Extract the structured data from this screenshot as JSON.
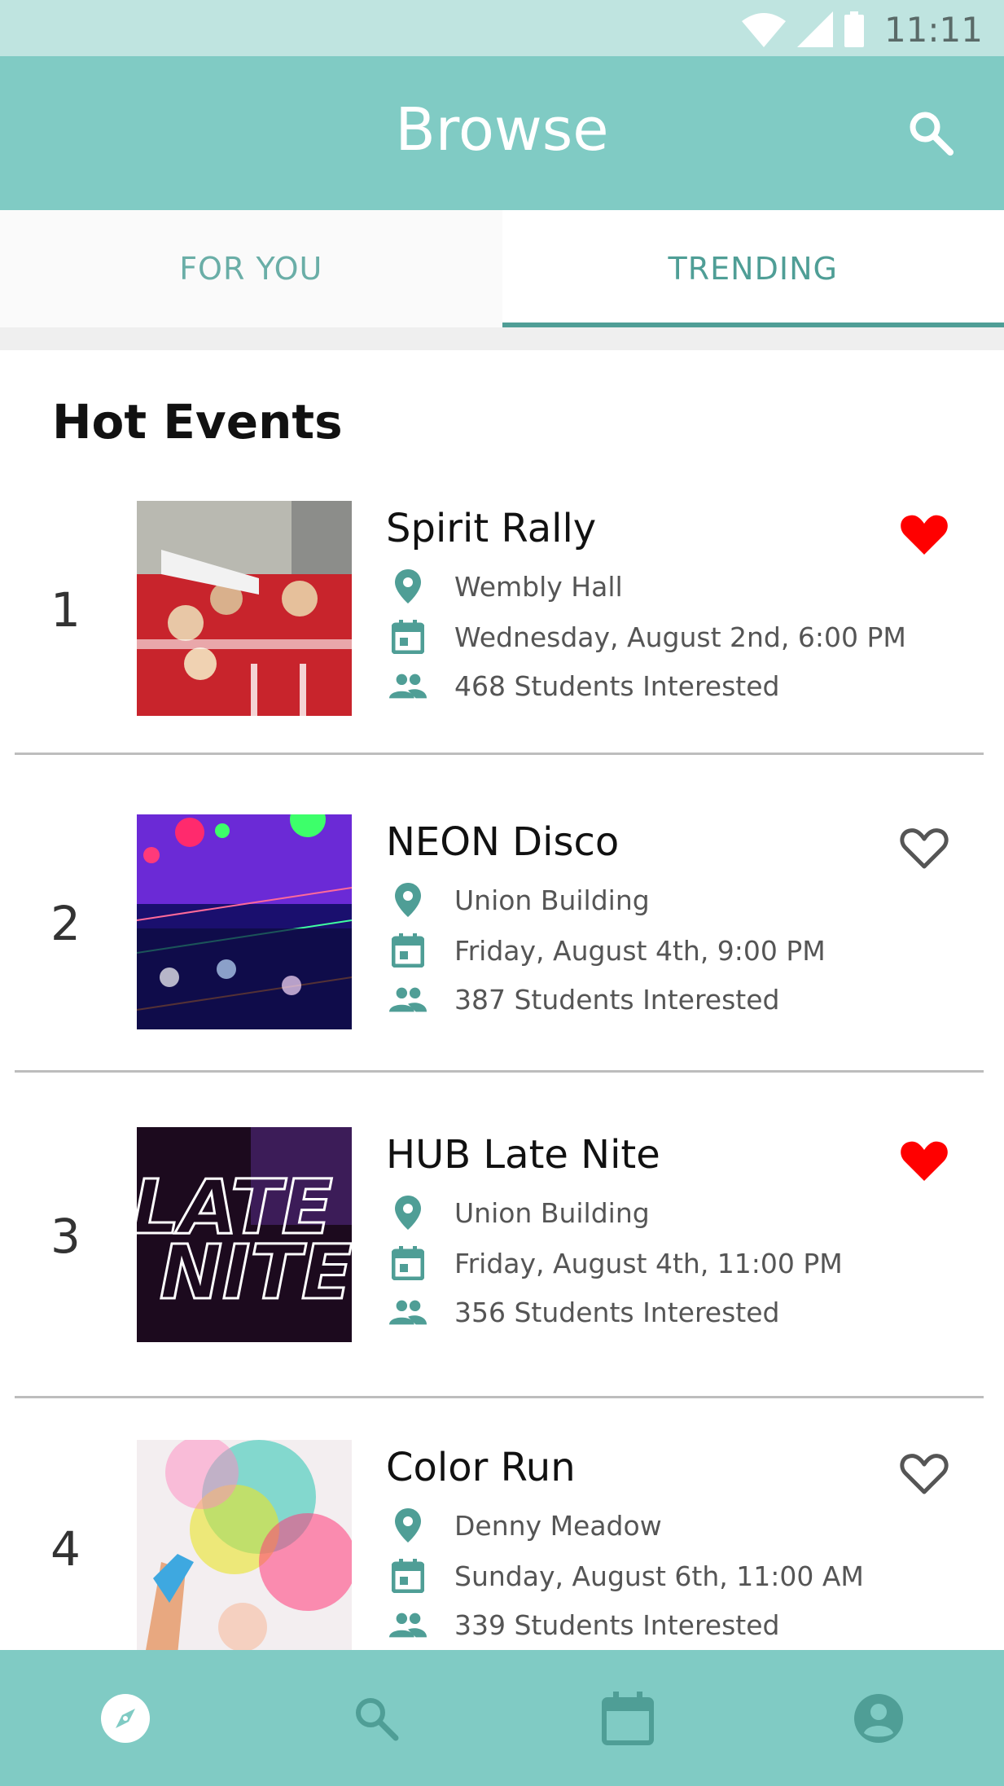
{
  "status_bar": {
    "time": "11:11"
  },
  "app_bar": {
    "title": "Browse"
  },
  "tabs": [
    {
      "label": "FOR YOU",
      "active": false
    },
    {
      "label": "TRENDING",
      "active": true
    }
  ],
  "section": {
    "title": "Hot Events"
  },
  "events": [
    {
      "rank": "1",
      "name": "Spirit Rally",
      "location": "Wembly Hall",
      "datetime": "Wednesday, August 2nd, 6:00 PM",
      "interested": "468 Students Interested",
      "favorited": true
    },
    {
      "rank": "2",
      "name": "NEON Disco",
      "location": "Union Building",
      "datetime": "Friday, August 4th, 9:00 PM",
      "interested": "387 Students Interested",
      "favorited": false
    },
    {
      "rank": "3",
      "name": "HUB Late Nite",
      "location": "Union Building",
      "datetime": "Friday, August 4th, 11:00 PM",
      "interested": "356 Students Interested",
      "favorited": true
    },
    {
      "rank": "4",
      "name": "Color Run",
      "location": "Denny Meadow",
      "datetime": "Sunday, August 6th, 11:00 AM",
      "interested": "339 Students Interested",
      "favorited": false
    }
  ],
  "bottom_nav": [
    {
      "icon": "compass-icon",
      "active": true
    },
    {
      "icon": "search-icon",
      "active": false
    },
    {
      "icon": "calendar-icon",
      "active": false
    },
    {
      "icon": "account-icon",
      "active": false
    }
  ],
  "colors": {
    "primary": "#80cbc4",
    "status_bar": "#bfe4e0",
    "accent": "#4f9e96",
    "heart": "#ff0000"
  }
}
